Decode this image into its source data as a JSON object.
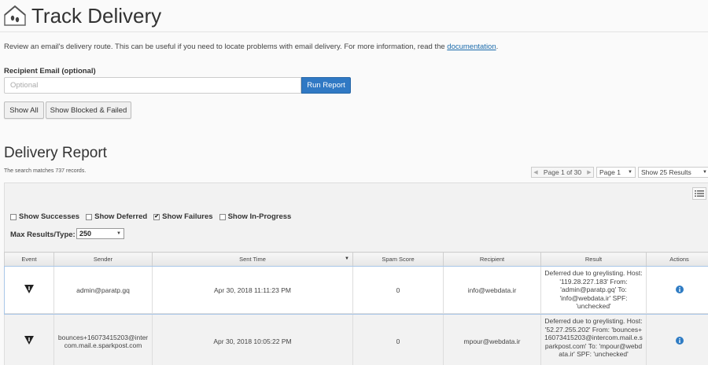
{
  "page": {
    "title": "Track Delivery",
    "intro": "Review an email's delivery route. This can be useful if you need to locate problems with email delivery. For more information, read the ",
    "intro_link": "documentation",
    "intro_end": "."
  },
  "form": {
    "recipient_label": "Recipient Email (optional)",
    "recipient_placeholder": "Optional",
    "recipient_value": "",
    "run_report_label": "Run Report",
    "show_all_label": "Show All",
    "show_blocked_label": "Show Blocked & Failed"
  },
  "report": {
    "title": "Delivery Report",
    "records_text": "The search matches 737 records.",
    "pager_text": "Page 1 of 30",
    "page_select": "Page 1",
    "results_select": "Show 25 Results",
    "filters": [
      {
        "label": "Show Successes",
        "checked": false
      },
      {
        "label": "Show Deferred",
        "checked": false
      },
      {
        "label": "Show Failures",
        "checked": true
      },
      {
        "label": "Show In-Progress",
        "checked": false
      }
    ],
    "max_label": "Max Results/Type:",
    "max_value": "250",
    "columns": [
      "Event",
      "Sender",
      "Sent Time",
      "Spam Score",
      "Recipient",
      "Result",
      "Actions"
    ],
    "rows": [
      {
        "event_icon": "deferred-warning-icon",
        "sender": "admin@paratp.gq",
        "sent_time": "Apr 30, 2018 11:11:23 PM",
        "spam_score": "0",
        "recipient": "info@webdata.ir",
        "result": "Deferred due to greylisting. Host: '119.28.227.183' From: 'admin@paratp.gq' To: 'info@webdata.ir' SPF: 'unchecked'",
        "action_icon": "info-icon"
      },
      {
        "event_icon": "deferred-warning-icon",
        "sender": "bounces+16073415203@intercom.mail.e.sparkpost.com",
        "sent_time": "Apr 30, 2018 10:05:22 PM",
        "spam_score": "0",
        "recipient": "mpour@webdata.ir",
        "result": "Deferred due to greylisting. Host: '52.27.255.202' From: 'bounces+16073415203@intercom.mail.e.sparkpost.com' To: 'mpour@webdata.ir' SPF: 'unchecked'",
        "action_icon": "info-icon"
      }
    ]
  },
  "colors": {
    "primary_button": "#3079c4",
    "link": "#1a6aab",
    "info_icon": "#2f7cc4"
  }
}
